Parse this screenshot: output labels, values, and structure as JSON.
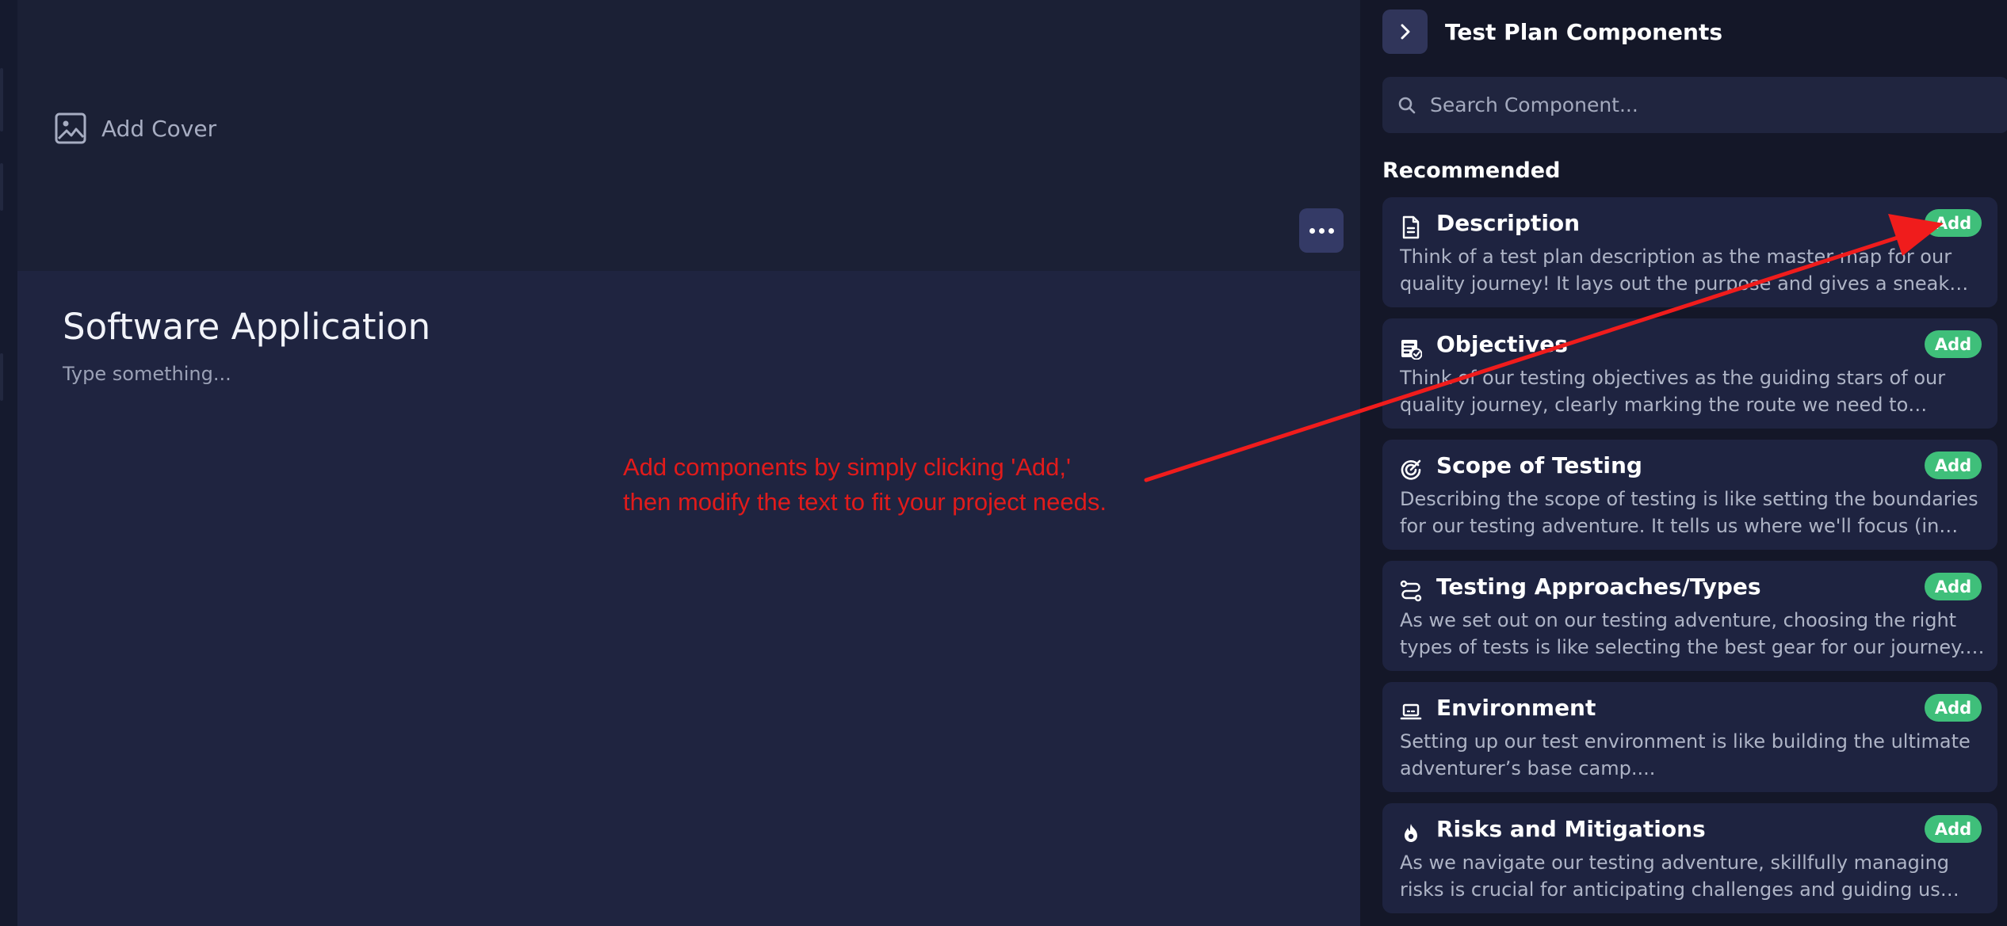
{
  "editor": {
    "add_cover_label": "Add Cover",
    "title": "Software Application",
    "body_placeholder": "Type something..."
  },
  "annotation": {
    "line1": "Add components by simply clicking 'Add,'",
    "line2": "then modify the text to fit your project needs.",
    "color": "#e11b1b"
  },
  "panel": {
    "title": "Test Plan Components",
    "search_placeholder": "Search Component...",
    "section_title": "Recommended",
    "add_label": "Add",
    "add_color": "#3fbf7a",
    "components": [
      {
        "title": "Description",
        "icon": "document-icon",
        "description": "Think of a test plan description as the master map for our quality journey! It lays out the purpose and gives a sneak peek..."
      },
      {
        "title": "Objectives",
        "icon": "checklist-icon",
        "description": "Think of our testing objectives as the guiding stars of our quality journey, clearly marking the route we need to follow...."
      },
      {
        "title": "Scope of Testing",
        "icon": "target-icon",
        "description": "Describing the scope of testing is like setting the boundaries for our testing adventure. It tells us where we'll focus (in scope..."
      },
      {
        "title": "Testing Approaches/Types",
        "icon": "route-icon",
        "description": "As we set out on our testing adventure, choosing the right types of tests is like selecting the best gear for our journey. Each tes..."
      },
      {
        "title": "Environment",
        "icon": "laptop-icon",
        "description": "Setting up our test environment is like building the ultimate adventurer’s base camp...."
      },
      {
        "title": "Risks and Mitigations",
        "icon": "flame-icon",
        "description": "As we navigate our testing adventure, skillfully managing risks is crucial for anticipating challenges and guiding us toward..."
      }
    ]
  }
}
